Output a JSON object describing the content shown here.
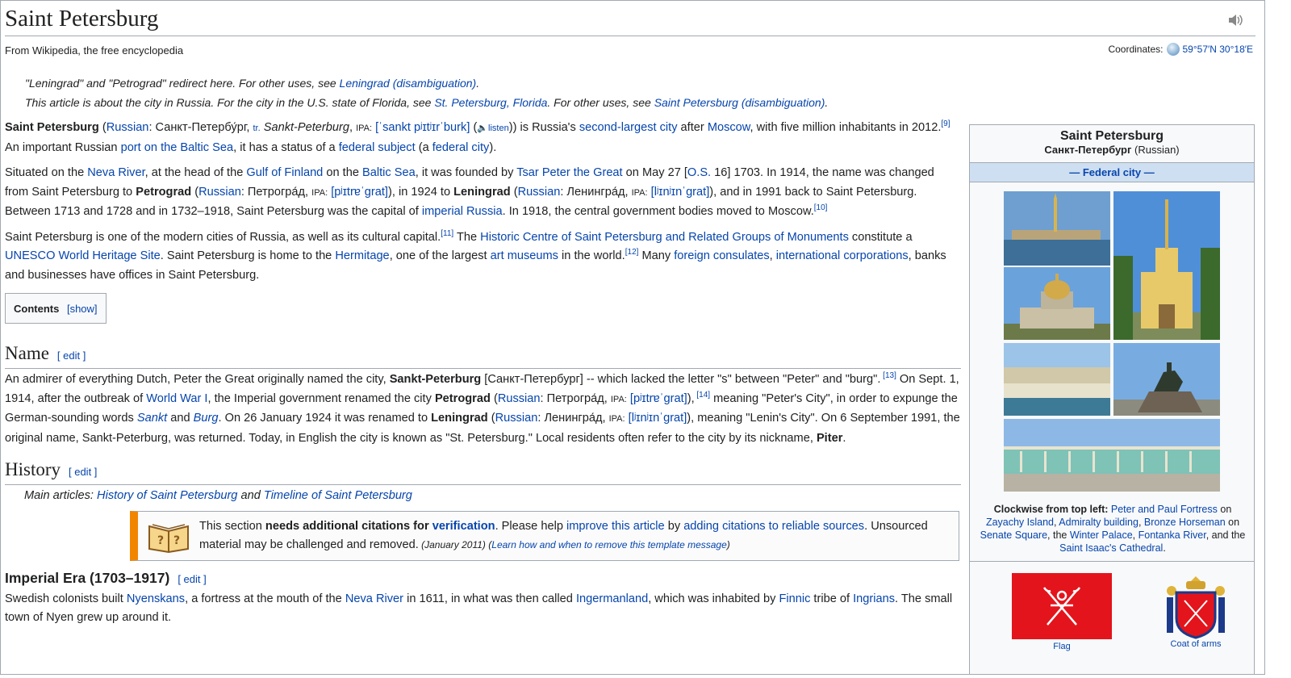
{
  "page": {
    "title": "Saint Petersburg",
    "tagline": "From Wikipedia, the free encyclopedia",
    "coords_label": "Coordinates:",
    "coords_value": "59°57′N 30°18′E"
  },
  "hatnotes": {
    "h1_pre": "\"Leningrad\" and \"Petrograd\" redirect here. For other uses, see ",
    "h1_link": "Leningrad (disambiguation)",
    "h1_post": ".",
    "h2_pre": "This article is about the city in Russia. For the city in the U.S. state of Florida, see ",
    "h2_link1": "St. Petersburg, Florida",
    "h2_mid": ". For other uses, see ",
    "h2_link2": "Saint Petersburg (disambiguation)",
    "h2_post": "."
  },
  "p1": {
    "a": "Saint Petersburg",
    "b": " (",
    "c": "Russian",
    "d": ": Санкт-Петербу́рг, ",
    "e": "tr.",
    "f": " Sankt-Peterburg",
    "g": ", ",
    "h": "IPA:",
    "i": " ",
    "j": "[ˈsankt pʲɪtʲɪrˈburk]",
    "k": " (",
    "l": "listen",
    "m": ")) is Russia's ",
    "n": "second-largest city",
    "o": " after ",
    "p": "Moscow",
    "q": ", with five million inhabitants in 2012.",
    "r": "[9]",
    "s": " An important Russian ",
    "t": "port on the Baltic Sea",
    "u": ", it has a status of a ",
    "v": "federal subject",
    "w": " (a ",
    "x": "federal city",
    "y": ")."
  },
  "p2": {
    "a": "Situated on the ",
    "b": "Neva River",
    "c": ", at the head of the ",
    "d": "Gulf of Finland",
    "e": " on the ",
    "f": "Baltic Sea",
    "g": ", it was founded by ",
    "h": "Tsar Peter the Great",
    "i": " on May 27 [",
    "j": "O.S.",
    "k": " 16] 1703. In 1914, the name was changed from Saint Petersburg to ",
    "l": "Petrograd",
    "m": " (",
    "n": "Russian",
    "o": ": Петрогра́д, ",
    "p": "IPA:",
    "q": " ",
    "r": "[pʲɪtrɐˈgrat]",
    "s": "), in 1924 to ",
    "t": "Leningrad",
    "u": " (",
    "v": "Russian",
    "w": ": Ленингра́д, ",
    "x": "IPA:",
    "y": " ",
    "z": "[lʲɪnʲɪnˈgrat]",
    "aa": "), and in 1991 back to Saint Petersburg. Between 1713 and 1728 and in 1732–1918, Saint Petersburg was the capital of ",
    "ab": "imperial Russia",
    "ac": ". In 1918, the central government bodies moved to Moscow.",
    "ad": "[10]"
  },
  "p3": {
    "a": "Saint Petersburg is one of the modern cities of Russia, as well as its cultural capital.",
    "b": "[11]",
    "c": " The ",
    "d": "Historic Centre of Saint Petersburg and Related Groups of Monuments",
    "e": " constitute a ",
    "f": "UNESCO World Heritage Site",
    "g": ". Saint Petersburg is home to the ",
    "h": "Hermitage",
    "i": ", one of the largest ",
    "j": "art museums",
    "k": " in the world.",
    "l": "[12]",
    "m": " Many ",
    "n": "foreign consulates",
    "o": ", ",
    "p": "international corporations",
    "q": ", banks and businesses have offices in Saint Petersburg."
  },
  "toc": {
    "label": "Contents",
    "show": "[show]"
  },
  "name_section": {
    "heading": "Name",
    "edit": "[ edit ]",
    "a": "An admirer of everything Dutch, Peter the Great originally named the city, ",
    "b": "Sankt-Peterburg",
    "c": " [Санкт-Петербург] -- which lacked the letter \"s\" between \"Peter\" and \"burg\".",
    "d": " [13]",
    "e": " On Sept. 1, 1914, after the outbreak of ",
    "f": "World War I",
    "g": ", the Imperial government renamed the city ",
    "h": "Petrograd",
    "i": " (",
    "j": "Russian",
    "k": ": Петрогра́д, ",
    "l": "IPA:",
    "m": " ",
    "n": "[pʲɪtrɐˈgrat]",
    "o": "),",
    "p": " [14]",
    "q": " meaning \"Peter's City\", in order to expunge the German-sounding words ",
    "r": "Sankt",
    "s": " and ",
    "t": "Burg",
    "u": ". On 26 January 1924 it was renamed to ",
    "v": "Leningrad",
    "w": " (",
    "x": "Russian",
    "y": ": Ленингра́д, ",
    "z": "IPA:",
    "aa": " ",
    "ab": "[lʲɪnʲɪnˈgrat]",
    "ac": "), meaning \"Lenin's City\". On 6 September 1991, the original name, Sankt-Peterburg, was returned. Today, in English the city is known as \"St. Petersburg.\" Local residents often refer to the city by its nickname, ",
    "ad": "Piter",
    "ae": "."
  },
  "history_section": {
    "heading": "History",
    "edit": "[ edit ]",
    "main_pre": "Main articles: ",
    "main_link1": "History of Saint Petersburg",
    "main_mid": " and ",
    "main_link2": "Timeline of Saint Petersburg",
    "amb_a": "This section ",
    "amb_b": "needs additional citations for ",
    "amb_c": "verification",
    "amb_d": ". Please help ",
    "amb_e": "improve this article",
    "amb_f": " by ",
    "amb_g": "adding citations to reliable sources",
    "amb_h": ". Unsourced material may be challenged and removed.",
    "amb_date": " (January 2011)",
    "amb_i": " (",
    "amb_j": "Learn how and when to remove this template message",
    "amb_k": ")"
  },
  "imperial_section": {
    "heading": "Imperial Era (1703–1917)",
    "edit": "[ edit ]",
    "a": "Swedish colonists built ",
    "b": "Nyenskans",
    "c": ", a fortress at the mouth of the ",
    "d": "Neva River",
    "e": " in 1611, in what was then called ",
    "f": "Ingermanland",
    "g": ", which was inhabited by ",
    "h": "Finnic",
    "i": " tribe of ",
    "j": "Ingrians",
    "k": ". The small town of Nyen grew up around it."
  },
  "infobox": {
    "title": "Saint Petersburg",
    "native": "Санкт-Петербург",
    "native_lang": " (Russian)",
    "subheader": "— Federal city —",
    "cap_a": "Clockwise from top left: ",
    "cap_b": "Peter and Paul Fortress",
    "cap_c": " on ",
    "cap_d": "Zayachy Island",
    "cap_e": ", ",
    "cap_f": "Admiralty building",
    "cap_g": ", ",
    "cap_h": "Bronze Horseman",
    "cap_i": " on ",
    "cap_j": "Senate Square",
    "cap_k": ", the ",
    "cap_l": "Winter Palace",
    "cap_m": ", ",
    "cap_n": "Fontanka River",
    "cap_o": ", and the ",
    "cap_p": "Saint Isaac's Cathedral",
    "cap_q": ".",
    "flag_label": "Flag",
    "coa_label": "Coat of arms"
  },
  "colors": {
    "link": "#0645ad",
    "infobox_sub": "#cedff2",
    "ambox_border": "#f28500",
    "flag_red": "#e4141c"
  }
}
